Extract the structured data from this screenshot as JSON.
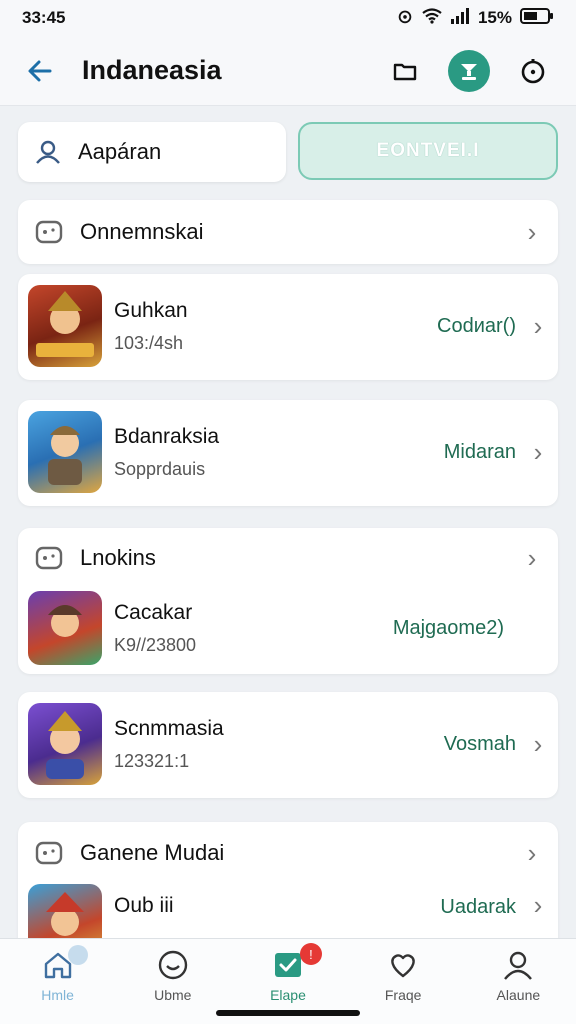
{
  "status": {
    "time": "33:45",
    "battery": "15%"
  },
  "header": {
    "title": "Indaneasia"
  },
  "search": {
    "text": "Aapáran"
  },
  "primary_button": {
    "label": "EONTVEI.I"
  },
  "sections": [
    {
      "title": "Onnemnskai",
      "games": [
        {
          "name": "Guhkan",
          "sub": "103:/4sh",
          "action": "Codиar()"
        },
        {
          "name": "Bdanraksia",
          "sub": "Sopprdauis",
          "action": "Midaran"
        }
      ]
    },
    {
      "title": "Lnokins",
      "games": [
        {
          "name": "Cacakar",
          "sub": "K9//23800",
          "action": "Majgaome2)"
        },
        {
          "name": "Scnmmasia",
          "sub": "123321:1",
          "action": "Vosmah"
        }
      ]
    },
    {
      "title": "Ganene Mudai",
      "games": [
        {
          "name": "Oub iii",
          "sub": "",
          "action": "Uadarak"
        }
      ]
    }
  ],
  "nav": [
    {
      "label": "Hmle",
      "icon": "home-icon"
    },
    {
      "label": "Ubme",
      "icon": "smile-icon"
    },
    {
      "label": "Elape",
      "icon": "check-icon",
      "badge": "!"
    },
    {
      "label": "Fraqe",
      "icon": "heart-icon"
    },
    {
      "label": "Alaune",
      "icon": "profile-icon"
    }
  ],
  "colors": {
    "accent": "#2a9a83",
    "back": "#1d6fa8",
    "action_text": "#1f6b52"
  }
}
